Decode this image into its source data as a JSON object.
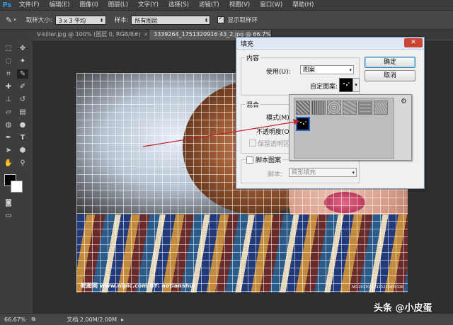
{
  "menubar": {
    "logo": "Ps",
    "items": [
      "文件(F)",
      "编辑(E)",
      "图像(I)",
      "图层(L)",
      "文字(Y)",
      "选择(S)",
      "滤镜(T)",
      "视图(V)",
      "窗口(W)",
      "帮助(H)"
    ]
  },
  "options": {
    "sample_size_label": "取样大小:",
    "sample_size_value": "3 x 3 平均",
    "sample_label": "样本:",
    "sample_value": "所有图层",
    "show_ring_label": "显示取样环"
  },
  "tabs": [
    {
      "label": "V-killer.jpg @ 100% (图层 0, RGB/8#)",
      "close": "×"
    },
    {
      "label": "3339264_1751320916 43_2.jpg @ 66.7%(RGB/8#)",
      "close": "×"
    }
  ],
  "canvas": {
    "watermark_left": "昵图网 www.nipic.com    BY: aotianshui",
    "watermark_right": "NO:20170212115220459326"
  },
  "status": {
    "zoom": "66.67%",
    "doc": "文档:2.00M/2.00M"
  },
  "dialog": {
    "title": "填充",
    "close": "✕",
    "content_group": "内容",
    "use_label": "使用(U):",
    "use_value": "图案",
    "custom_pattern_label": "自定图案:",
    "blend_group": "混合",
    "mode_label": "模式(M):",
    "opacity_label": "不透明度(O):",
    "preserve_label": "保留透明区域",
    "script_group_label": "脚本图案",
    "script_label": "脚本:",
    "script_value": "砖形填充",
    "ok": "确定",
    "cancel": "取消"
  },
  "colors": {
    "dialog_border": "#6e8fb6",
    "arrow": "#c0232c",
    "close_btn": "#c94536"
  },
  "watermark": {
    "text": "头条 @小皮蛋"
  }
}
